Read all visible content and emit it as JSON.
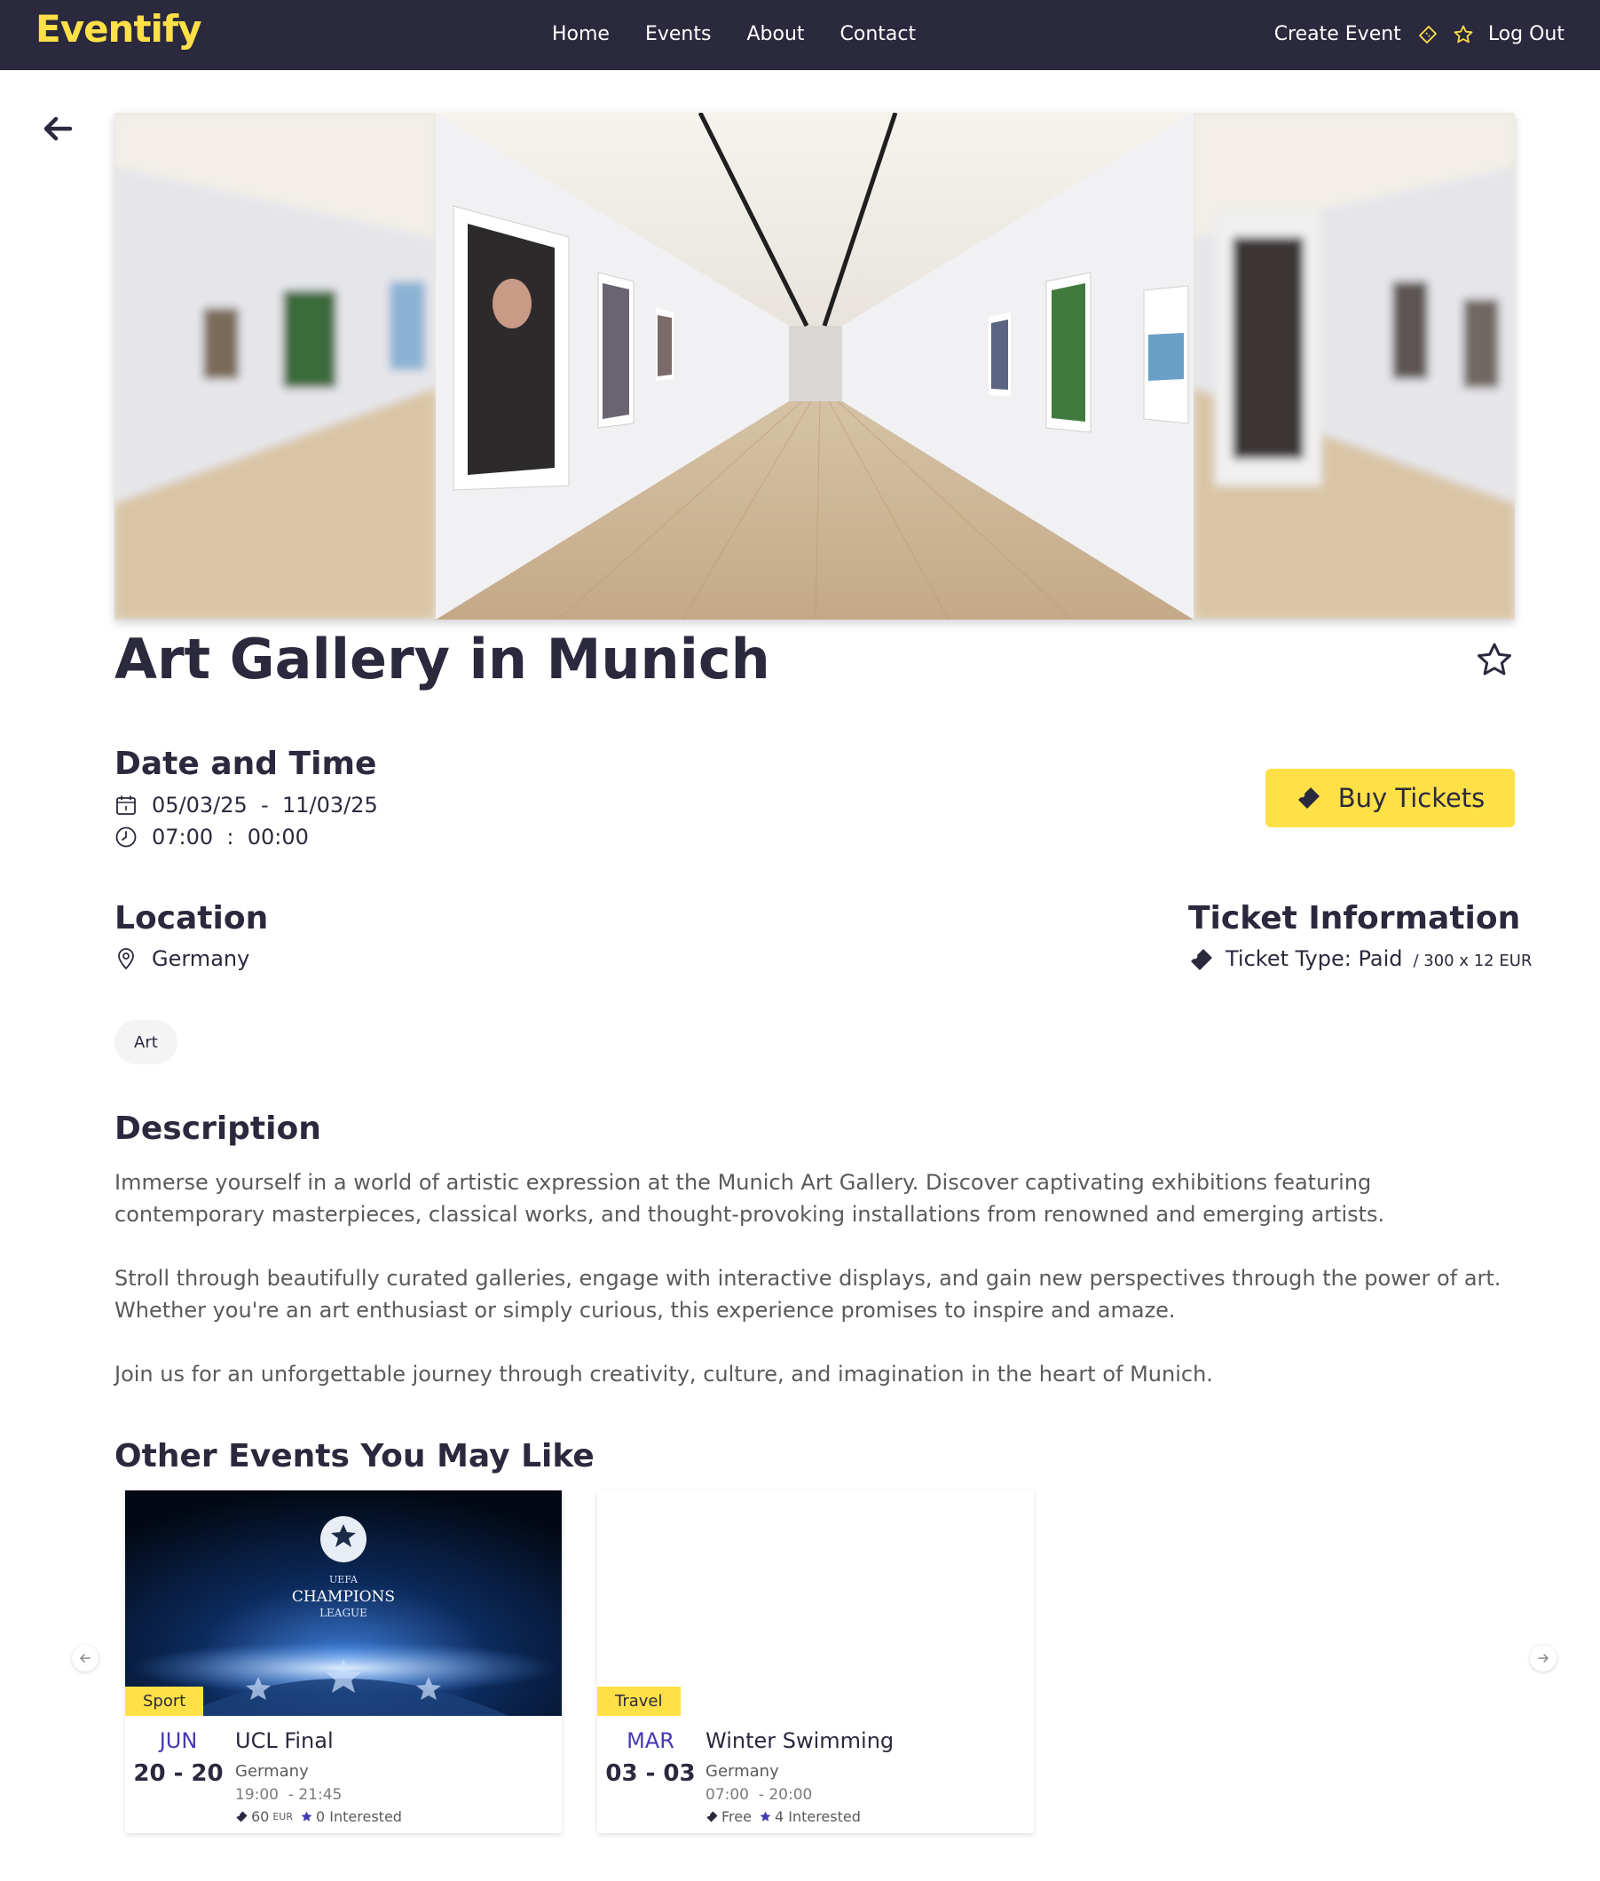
{
  "brand": {
    "name": "Eventify",
    "accent": "#ffe047",
    "dark": "#2b293d",
    "purple": "#4539b4"
  },
  "nav": {
    "links": [
      "Home",
      "Events",
      "About",
      "Contact"
    ],
    "create_event": "Create Event",
    "ticket_icon": "ticket-icon",
    "star_icon": "star-icon",
    "logout": "Log Out"
  },
  "event": {
    "title": "Art Gallery in Munich",
    "date_heading": "Date and Time",
    "date_range": "05/03/25  -  11/03/25",
    "time_range": "07:00  :  00:00",
    "buy_label": "Buy Tickets",
    "location_heading": "Location",
    "location": "Germany",
    "ticket_heading": "Ticket Information",
    "ticket_type": "Ticket Type: Paid",
    "ticket_price": "/ 300 x 12 EUR",
    "tag": "Art",
    "description_heading": "Description",
    "description": [
      "Immerse yourself in a world of artistic expression at the Munich Art Gallery. Discover captivating exhibitions featuring contemporary masterpieces, classical works, and thought-provoking installations from renowned and emerging artists.",
      "Stroll through beautifully curated galleries, engage with interactive displays, and gain new perspectives through the power of art. Whether you're an art enthusiast or simply curious, this experience promises to inspire and amaze.",
      "Join us for an unforgettable journey through creativity, culture, and imagination in the heart of Munich."
    ]
  },
  "related": {
    "heading": "Other Events You May Like",
    "cards": [
      {
        "category": "Sport",
        "month": "JUN",
        "days": "20 - 20",
        "name": "UCL Final",
        "location": "Germany",
        "time": "19:00  - 21:45",
        "price": "60",
        "currency": "EUR",
        "interested": "0 Interested",
        "banner_line1": "UEFA",
        "banner_line2": "CHAMPIONS",
        "banner_line3": "LEAGUE"
      },
      {
        "category": "Travel",
        "month": "MAR",
        "days": "03 - 03",
        "name": "Winter Swimming",
        "location": "Germany",
        "time": "07:00  - 20:00",
        "price": "Free",
        "currency": "",
        "interested": "4 Interested"
      }
    ]
  }
}
